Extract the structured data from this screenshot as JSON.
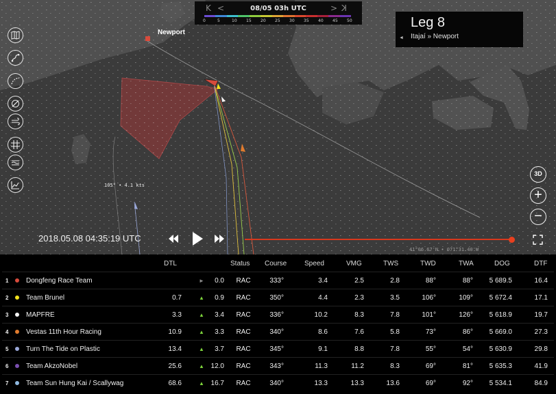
{
  "timebar": {
    "date": "08/05 03h UTC",
    "first_label": "K",
    "prev_label": "<",
    "next_label": ">",
    "last_label": "K",
    "scale_colors": [
      "#6b4dd4",
      "#3f88d9",
      "#3ec0cf",
      "#4fc46a",
      "#90cc3e",
      "#c9c935",
      "#e0a437",
      "#e07431",
      "#d94a2f",
      "#c9302f",
      "#a8203a",
      "#8a2a8e",
      "#6b34b0"
    ],
    "scale_labels": [
      "0",
      "5",
      "10",
      "15",
      "20",
      "25",
      "30",
      "35",
      "40",
      "45",
      "50"
    ]
  },
  "leg": {
    "title": "Leg 8",
    "route": "Itajaí » Newport",
    "arrow": "◄"
  },
  "map": {
    "place_label": "Newport",
    "boat_info": "105° • 4.1 kts",
    "coords": "41°06.67'N • 071°31.40'W"
  },
  "tools": [
    {
      "name": "map-layers-icon"
    },
    {
      "name": "route-icon"
    },
    {
      "name": "distance-arc-icon"
    },
    {
      "name": "compass-icon"
    },
    {
      "name": "wind-icon"
    },
    {
      "name": "grid-icon"
    },
    {
      "name": "currents-icon"
    },
    {
      "name": "chart-icon"
    }
  ],
  "controls": {
    "view_3d": "3D",
    "zoom_in": "+",
    "zoom_out": "−"
  },
  "playback": {
    "datetime": "2018.05.08 04:35:19 UTC",
    "progress": 0.99
  },
  "table": {
    "headers": {
      "dtl": "DTL",
      "status": "Status",
      "course": "Course",
      "speed": "Speed",
      "vmg": "VMG",
      "tws": "TWS",
      "twd": "TWD",
      "twa": "TWA",
      "dog": "DOG",
      "dtf": "DTF"
    },
    "rows": [
      {
        "rank": "1",
        "color": "#d84b3c",
        "team": "Dongfeng Race Team",
        "dtl": "",
        "trend": "►",
        "trend_type": "right",
        "delta": "0.0",
        "status": "RAC",
        "course": "333°",
        "speed": "3.4",
        "vmg": "2.5",
        "tws": "2.8",
        "twd": "88°",
        "twa": "88°",
        "dog": "5 689.5",
        "dtf": "16.4"
      },
      {
        "rank": "2",
        "color": "#f2e21d",
        "team": "Team Brunel",
        "dtl": "0.7",
        "trend": "▲",
        "trend_type": "up",
        "delta": "0.9",
        "status": "RAC",
        "course": "350°",
        "speed": "4.4",
        "vmg": "2.3",
        "tws": "3.5",
        "twd": "106°",
        "twa": "109°",
        "dog": "5 672.4",
        "dtf": "17.1"
      },
      {
        "rank": "3",
        "color": "#f4f4f4",
        "team": "MAPFRE",
        "dtl": "3.3",
        "trend": "▲",
        "trend_type": "up",
        "delta": "3.4",
        "status": "RAC",
        "course": "336°",
        "speed": "10.2",
        "vmg": "8.3",
        "tws": "7.8",
        "twd": "101°",
        "twa": "126°",
        "dog": "5 618.9",
        "dtf": "19.7"
      },
      {
        "rank": "4",
        "color": "#e07b2e",
        "team": "Vestas 11th Hour Racing",
        "dtl": "10.9",
        "trend": "▲",
        "trend_type": "up",
        "delta": "3.3",
        "status": "RAC",
        "course": "340°",
        "speed": "8.6",
        "vmg": "7.6",
        "tws": "5.8",
        "twd": "73°",
        "twa": "86°",
        "dog": "5 669.0",
        "dtf": "27.3"
      },
      {
        "rank": "5",
        "color": "#9aa8d9",
        "team": "Turn The Tide on Plastic",
        "dtl": "13.4",
        "trend": "▲",
        "trend_type": "up",
        "delta": "3.7",
        "status": "RAC",
        "course": "345°",
        "speed": "9.1",
        "vmg": "8.8",
        "tws": "7.8",
        "twd": "55°",
        "twa": "54°",
        "dog": "5 630.9",
        "dtf": "29.8"
      },
      {
        "rank": "6",
        "color": "#7a4fb0",
        "team": "Team AkzoNobel",
        "dtl": "25.6",
        "trend": "▲",
        "trend_type": "up",
        "delta": "12.0",
        "status": "RAC",
        "course": "343°",
        "speed": "11.3",
        "vmg": "11.2",
        "tws": "8.3",
        "twd": "69°",
        "twa": "81°",
        "dog": "5 635.3",
        "dtf": "41.9"
      },
      {
        "rank": "7",
        "color": "#8fb9e0",
        "team": "Team Sun Hung Kai / Scallywag",
        "dtl": "68.6",
        "trend": "▲",
        "trend_type": "up",
        "delta": "16.7",
        "status": "RAC",
        "course": "340°",
        "speed": "13.3",
        "vmg": "13.3",
        "tws": "13.6",
        "twd": "69°",
        "twa": "92°",
        "dog": "5 534.1",
        "dtf": "84.9"
      }
    ]
  }
}
